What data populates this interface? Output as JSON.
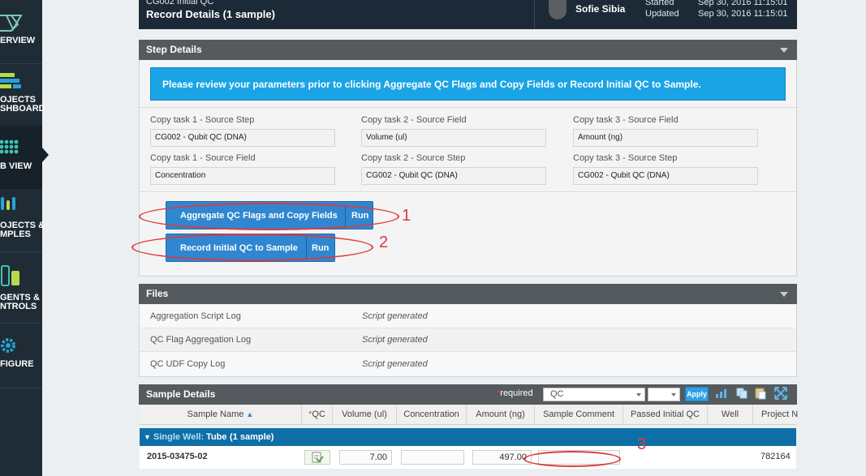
{
  "nav": {
    "items": [
      {
        "label": "ERVIEW",
        "icon": "overview-icon"
      },
      {
        "label": "OJECTS",
        "label2": "SHBOARD",
        "icon": "projects-dashboard-icon"
      },
      {
        "label": "B VIEW",
        "icon": "lab-view-icon"
      },
      {
        "label": "OJECTS &",
        "label2": "MPLES",
        "icon": "projects-samples-icon"
      },
      {
        "label": "GENTS &",
        "label2": "NTROLS",
        "icon": "reagents-controls-icon"
      },
      {
        "label": "FIGURE",
        "icon": "gear-icon"
      }
    ]
  },
  "header": {
    "step_name": "CG002 Initial QC",
    "title": "Record Details (1 sample)",
    "user": "Sofie Sibia",
    "started_label": "Started",
    "started_value": "Sep 30, 2016 11:15:01",
    "updated_label": "Updated",
    "updated_value": "Sep 30, 2016 11:15:01"
  },
  "step_details": {
    "title": "Step Details",
    "banner": "Please review your parameters prior to clicking Aggregate QC Flags and Copy Fields or Record Initial QC to Sample.",
    "fields": [
      {
        "label": "Copy task 1 - Source Step",
        "value": "CG002 - Qubit QC (DNA)"
      },
      {
        "label": "Copy task 2 - Source Field",
        "value": "Volume (ul)"
      },
      {
        "label": "Copy task 3 - Source Field",
        "value": "Amount (ng)"
      },
      {
        "label": "Copy task 1 - Source Field",
        "value": "Concentration"
      },
      {
        "label": "Copy task 2 - Source Step",
        "value": "CG002 - Qubit QC (DNA)"
      },
      {
        "label": "Copy task 3 - Source Step",
        "value": "CG002 - Qubit QC (DNA)"
      }
    ],
    "buttons": [
      {
        "label": "Aggregate QC Flags and Copy Fields",
        "run": "Run"
      },
      {
        "label": "Record Initial QC to Sample",
        "run": "Run"
      }
    ]
  },
  "annotations": {
    "one": "1",
    "two": "2",
    "three": "3"
  },
  "files": {
    "title": "Files",
    "rows": [
      {
        "name": "Aggregation Script Log",
        "value": "Script generated"
      },
      {
        "name": "QC Flag Aggregation Log",
        "value": "Script generated"
      },
      {
        "name": "QC UDF Copy Log",
        "value": "Script generated"
      }
    ]
  },
  "sample_details": {
    "title": "Sample Details",
    "required_star": "*",
    "required_label": "required",
    "filter_value": "QC",
    "apply_label": "Apply",
    "columns": [
      "Sample Name",
      "*",
      "QC",
      "Volume (ul)",
      "Concentration",
      "Amount (ng)",
      "Sample Comment",
      "Passed Initial QC",
      "Well",
      "Project N"
    ],
    "group": {
      "prefix": "Single Well:",
      "container": "Tube",
      "count": "(1 sample)"
    },
    "row": {
      "sample_name": "2015-03475-02",
      "volume": "7.00",
      "concentration": "",
      "amount": "497.00",
      "comment": "",
      "project": "782164"
    }
  },
  "colors": {
    "accent": "#2f87d1",
    "banner": "#1aa4e5",
    "annotation": "#e0393a",
    "group_row": "#0e6fa6"
  }
}
